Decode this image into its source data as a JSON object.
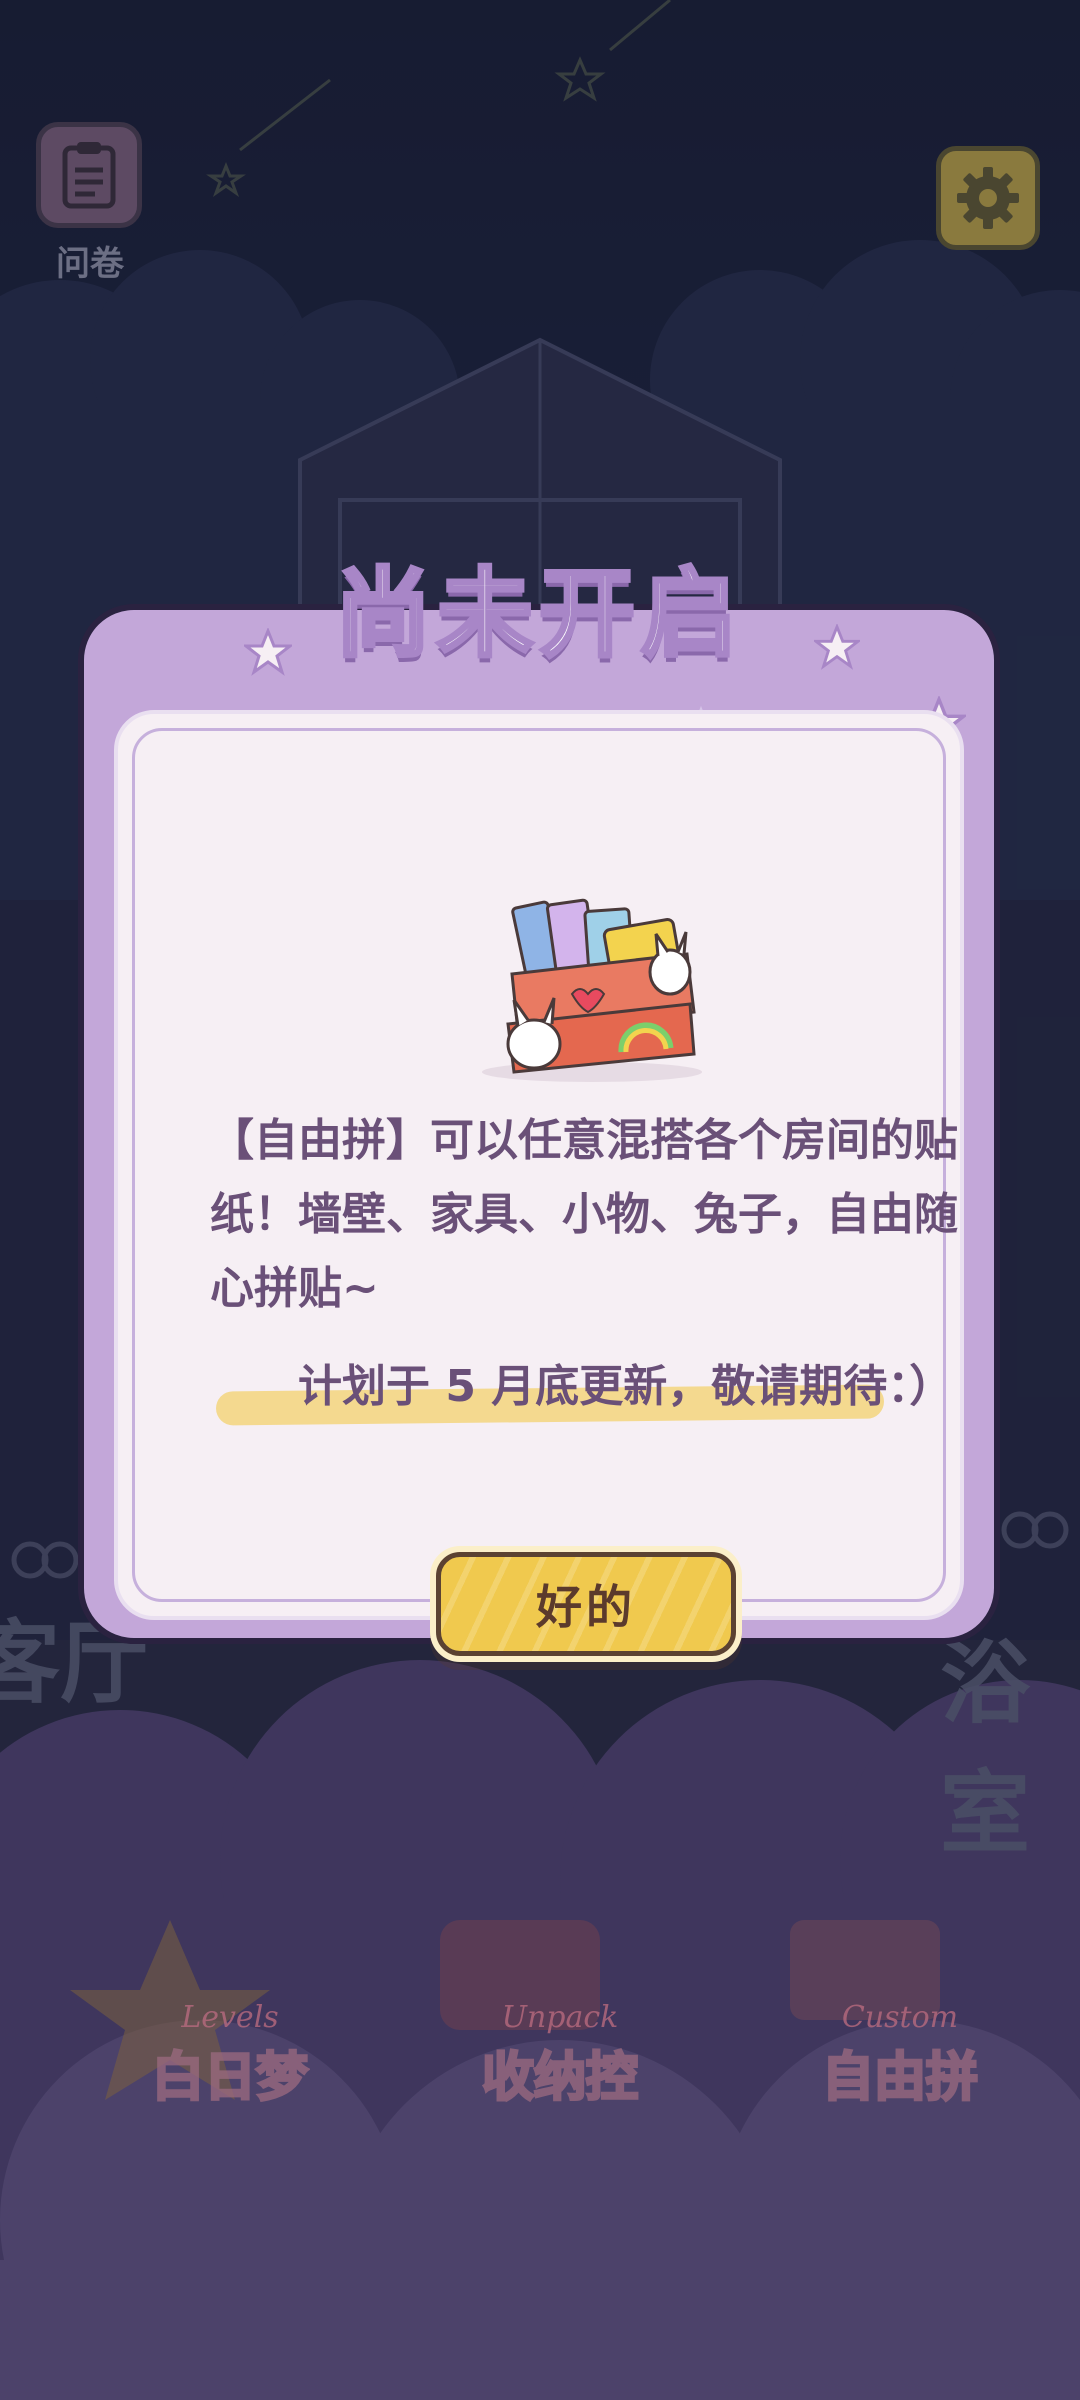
{
  "top_bar": {
    "survey_label": "问卷",
    "survey_icon": "clipboard-icon",
    "settings_icon": "gear-icon"
  },
  "side_labels": {
    "left": "客厅",
    "right": "浴室"
  },
  "bottom_menu": [
    {
      "sub": "Levels",
      "title": "白日梦",
      "icon": "star-icon"
    },
    {
      "sub": "Unpack",
      "title": "收纳控",
      "icon": "suitcase-icon"
    },
    {
      "sub": "Custom",
      "title": "自由拼",
      "icon": "sticker-box-icon"
    }
  ],
  "dialog": {
    "title": "尚未开启",
    "illustration": "book-box-with-bunnies",
    "body": "【自由拼】可以任意混搭各个房间的贴纸！墙壁、家具、小物、兔子，自由随心拼贴~",
    "schedule": "计划于 5 月底更新，敬请期待：）",
    "ok_button": "好的"
  },
  "colors": {
    "dialog_frame": "#c3a7d9",
    "dialog_panel": "#f6eff4",
    "text": "#6a5078",
    "button": "#f0c94e",
    "highlight": "#f3d57c"
  }
}
